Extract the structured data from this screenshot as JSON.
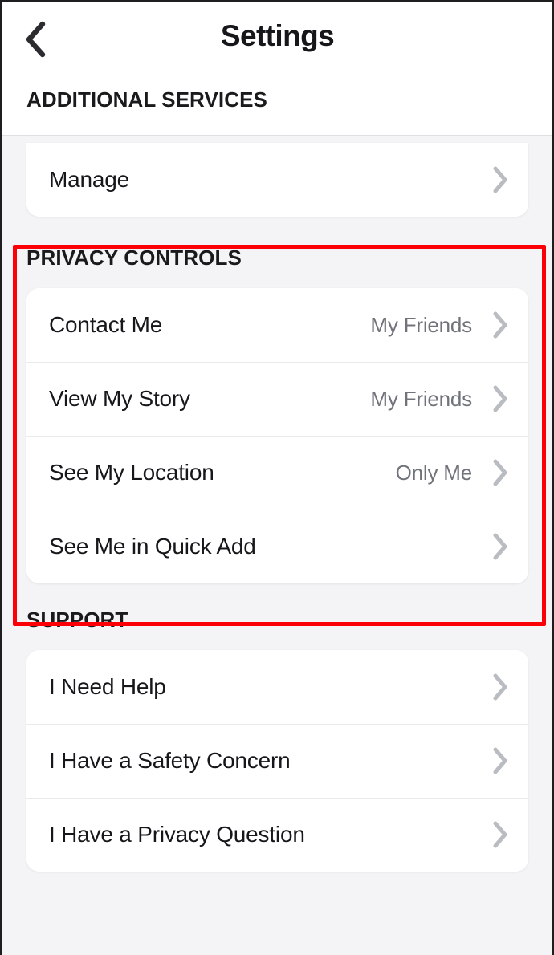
{
  "header": {
    "back_icon": "chevron-left-icon",
    "title": "Settings"
  },
  "sections": [
    {
      "id": "additional-services",
      "title": "ADDITIONAL SERVICES",
      "rows": [
        {
          "label": "Manage",
          "value": "",
          "chevron": "chevron-right-icon"
        }
      ]
    },
    {
      "id": "privacy-controls",
      "title": "PRIVACY CONTROLS",
      "highlighted": true,
      "rows": [
        {
          "label": "Contact Me",
          "value": "My Friends",
          "chevron": "chevron-right-icon"
        },
        {
          "label": "View My Story",
          "value": "My Friends",
          "chevron": "chevron-right-icon"
        },
        {
          "label": "See My Location",
          "value": "Only Me",
          "chevron": "chevron-right-icon"
        },
        {
          "label": "See Me in Quick Add",
          "value": "",
          "chevron": "chevron-right-icon"
        }
      ]
    },
    {
      "id": "support",
      "title": "SUPPORT",
      "rows": [
        {
          "label": "I Need Help",
          "value": "",
          "chevron": "chevron-right-icon"
        },
        {
          "label": "I Have a Safety Concern",
          "value": "",
          "chevron": "chevron-right-icon"
        },
        {
          "label": "I Have a Privacy Question",
          "value": "",
          "chevron": "chevron-right-icon"
        }
      ]
    }
  ],
  "annotation": {
    "type": "highlight-rectangle",
    "color": "#fb0007",
    "target_section": "PRIVACY CONTROLS"
  },
  "colors": {
    "background": "#f4f4f6",
    "card": "#ffffff",
    "text_primary": "#16171a",
    "text_secondary": "#70747a",
    "chevron": "#b9bdc2",
    "annotation_red": "#fb0007"
  }
}
